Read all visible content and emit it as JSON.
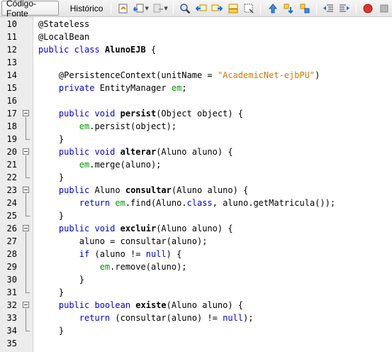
{
  "toolbar": {
    "tab_source": "Código-Fonte",
    "tab_history": "Histórico",
    "icons": [
      "last-edit-icon",
      "back-icon",
      "forward-icon",
      "find-icon",
      "find-previous-icon",
      "find-next-icon",
      "find-selection-icon",
      "toggle-highlight-icon",
      "toggle-bookmark-icon",
      "previous-bookmark-icon",
      "next-bookmark-icon",
      "shift-left-icon",
      "shift-right-icon",
      "stop-macro-icon",
      "start-macro-icon"
    ]
  },
  "editor": {
    "lines": [
      {
        "n": "10",
        "segs": [
          {
            "t": "@Stateless",
            "c": "ann"
          }
        ]
      },
      {
        "n": "11",
        "segs": [
          {
            "t": "@LocalBean",
            "c": "ann"
          }
        ]
      },
      {
        "n": "12",
        "segs": [
          {
            "t": "public class ",
            "c": "kw"
          },
          {
            "t": "AlunoEJB",
            "c": "b"
          },
          {
            "t": " {",
            "c": ""
          }
        ]
      },
      {
        "n": "13",
        "segs": []
      },
      {
        "n": "14",
        "segs": [
          {
            "t": "    @PersistenceContext(unitName = ",
            "c": ""
          },
          {
            "t": "\"AcademicNet-ejbPU\"",
            "c": "str"
          },
          {
            "t": ")",
            "c": ""
          }
        ]
      },
      {
        "n": "15",
        "segs": [
          {
            "t": "    ",
            "c": ""
          },
          {
            "t": "private",
            "c": "kw"
          },
          {
            "t": " EntityManager ",
            "c": ""
          },
          {
            "t": "em",
            "c": "fld"
          },
          {
            "t": ";",
            "c": ""
          }
        ]
      },
      {
        "n": "16",
        "segs": []
      },
      {
        "n": "17",
        "segs": [
          {
            "t": "    ",
            "c": ""
          },
          {
            "t": "public void ",
            "c": "kw"
          },
          {
            "t": "persist",
            "c": "b"
          },
          {
            "t": "(Object object) {",
            "c": ""
          }
        ]
      },
      {
        "n": "18",
        "segs": [
          {
            "t": "        ",
            "c": ""
          },
          {
            "t": "em",
            "c": "fld"
          },
          {
            "t": ".persist(object);",
            "c": ""
          }
        ]
      },
      {
        "n": "19",
        "segs": [
          {
            "t": "    }",
            "c": ""
          }
        ]
      },
      {
        "n": "20",
        "segs": [
          {
            "t": "    ",
            "c": ""
          },
          {
            "t": "public void ",
            "c": "kw"
          },
          {
            "t": "alterar",
            "c": "b"
          },
          {
            "t": "(Aluno aluno) {",
            "c": ""
          }
        ]
      },
      {
        "n": "21",
        "segs": [
          {
            "t": "        ",
            "c": ""
          },
          {
            "t": "em",
            "c": "fld"
          },
          {
            "t": ".merge(aluno);",
            "c": ""
          }
        ]
      },
      {
        "n": "22",
        "segs": [
          {
            "t": "    }",
            "c": ""
          }
        ]
      },
      {
        "n": "23",
        "segs": [
          {
            "t": "    ",
            "c": ""
          },
          {
            "t": "public",
            "c": "kw"
          },
          {
            "t": " Aluno ",
            "c": ""
          },
          {
            "t": "consultar",
            "c": "b"
          },
          {
            "t": "(Aluno aluno) {",
            "c": ""
          }
        ]
      },
      {
        "n": "24",
        "segs": [
          {
            "t": "        ",
            "c": ""
          },
          {
            "t": "return ",
            "c": "kw"
          },
          {
            "t": "em",
            "c": "fld"
          },
          {
            "t": ".find(Aluno.",
            "c": ""
          },
          {
            "t": "class",
            "c": "kw"
          },
          {
            "t": ", aluno.getMatricula());",
            "c": ""
          }
        ]
      },
      {
        "n": "25",
        "segs": [
          {
            "t": "    }",
            "c": ""
          }
        ]
      },
      {
        "n": "26",
        "segs": [
          {
            "t": "    ",
            "c": ""
          },
          {
            "t": "public void ",
            "c": "kw"
          },
          {
            "t": "excluir",
            "c": "b"
          },
          {
            "t": "(Aluno aluno) {",
            "c": ""
          }
        ]
      },
      {
        "n": "27",
        "segs": [
          {
            "t": "        aluno = consultar(aluno);",
            "c": ""
          }
        ]
      },
      {
        "n": "28",
        "segs": [
          {
            "t": "        ",
            "c": ""
          },
          {
            "t": "if",
            "c": "kw"
          },
          {
            "t": " (aluno != ",
            "c": ""
          },
          {
            "t": "null",
            "c": "kw"
          },
          {
            "t": ") {",
            "c": ""
          }
        ]
      },
      {
        "n": "29",
        "segs": [
          {
            "t": "            ",
            "c": ""
          },
          {
            "t": "em",
            "c": "fld"
          },
          {
            "t": ".remove(aluno);",
            "c": ""
          }
        ]
      },
      {
        "n": "30",
        "segs": [
          {
            "t": "        }",
            "c": ""
          }
        ]
      },
      {
        "n": "31",
        "segs": [
          {
            "t": "    }",
            "c": ""
          }
        ]
      },
      {
        "n": "32",
        "segs": [
          {
            "t": "    ",
            "c": ""
          },
          {
            "t": "public boolean ",
            "c": "kw"
          },
          {
            "t": "existe",
            "c": "b"
          },
          {
            "t": "(Aluno aluno) {",
            "c": ""
          }
        ]
      },
      {
        "n": "33",
        "segs": [
          {
            "t": "        ",
            "c": ""
          },
          {
            "t": "return",
            "c": "kw"
          },
          {
            "t": " (consultar(aluno) != ",
            "c": ""
          },
          {
            "t": "null",
            "c": "kw"
          },
          {
            "t": ");",
            "c": ""
          }
        ]
      },
      {
        "n": "34",
        "segs": [
          {
            "t": "    }",
            "c": ""
          }
        ]
      },
      {
        "n": "35",
        "segs": []
      }
    ],
    "folds": [
      {
        "start": 17,
        "end": 19
      },
      {
        "start": 20,
        "end": 22
      },
      {
        "start": 23,
        "end": 25
      },
      {
        "start": 26,
        "end": 31
      },
      {
        "start": 32,
        "end": 34
      }
    ]
  }
}
